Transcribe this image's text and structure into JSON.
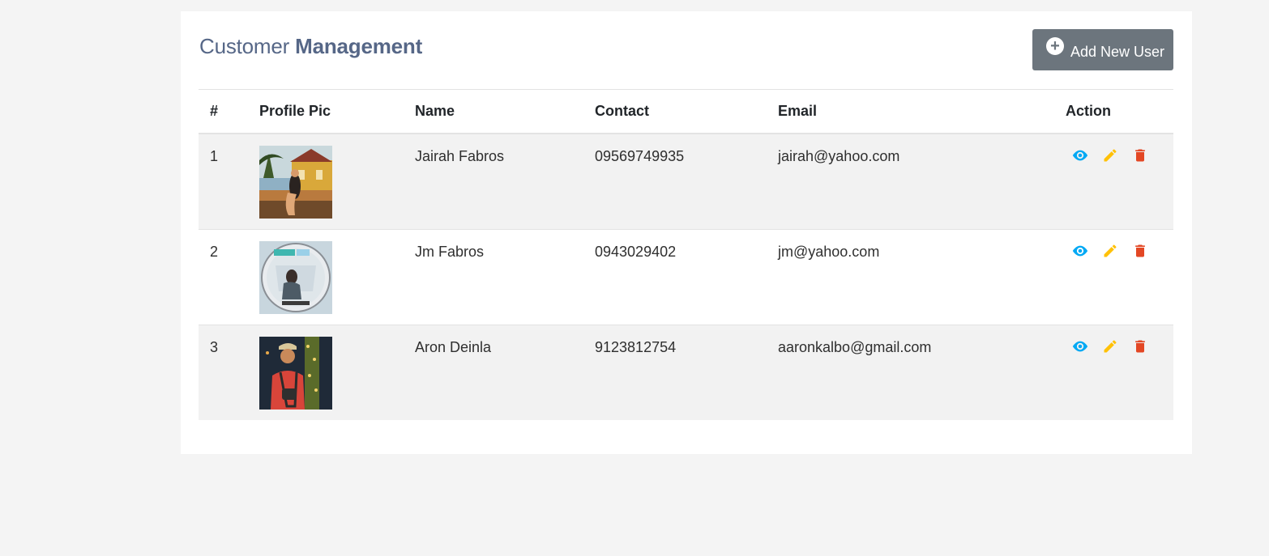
{
  "header": {
    "title_light": "Customer",
    "title_bold": "Management",
    "add_button_label": "Add New User"
  },
  "table": {
    "columns": [
      "#",
      "Profile Pic",
      "Name",
      "Contact",
      "Email",
      "Action"
    ],
    "rows": [
      {
        "num": "1",
        "name": "Jairah Fabros",
        "contact": "09569749935",
        "email": "jairah@yahoo.com"
      },
      {
        "num": "2",
        "name": "Jm Fabros",
        "contact": "0943029402",
        "email": "jm@yahoo.com"
      },
      {
        "num": "3",
        "name": "Aron Deinla",
        "contact": "9123812754",
        "email": "aaronkalbo@gmail.com"
      }
    ]
  },
  "icons": {
    "view": "eye-icon",
    "edit": "pencil-icon",
    "delete": "trash-icon",
    "add": "plus-circle-icon"
  },
  "colors": {
    "view": "#03a9f4",
    "edit": "#ffc107",
    "delete": "#e34724",
    "button": "#6c757d",
    "title": "#566787"
  }
}
